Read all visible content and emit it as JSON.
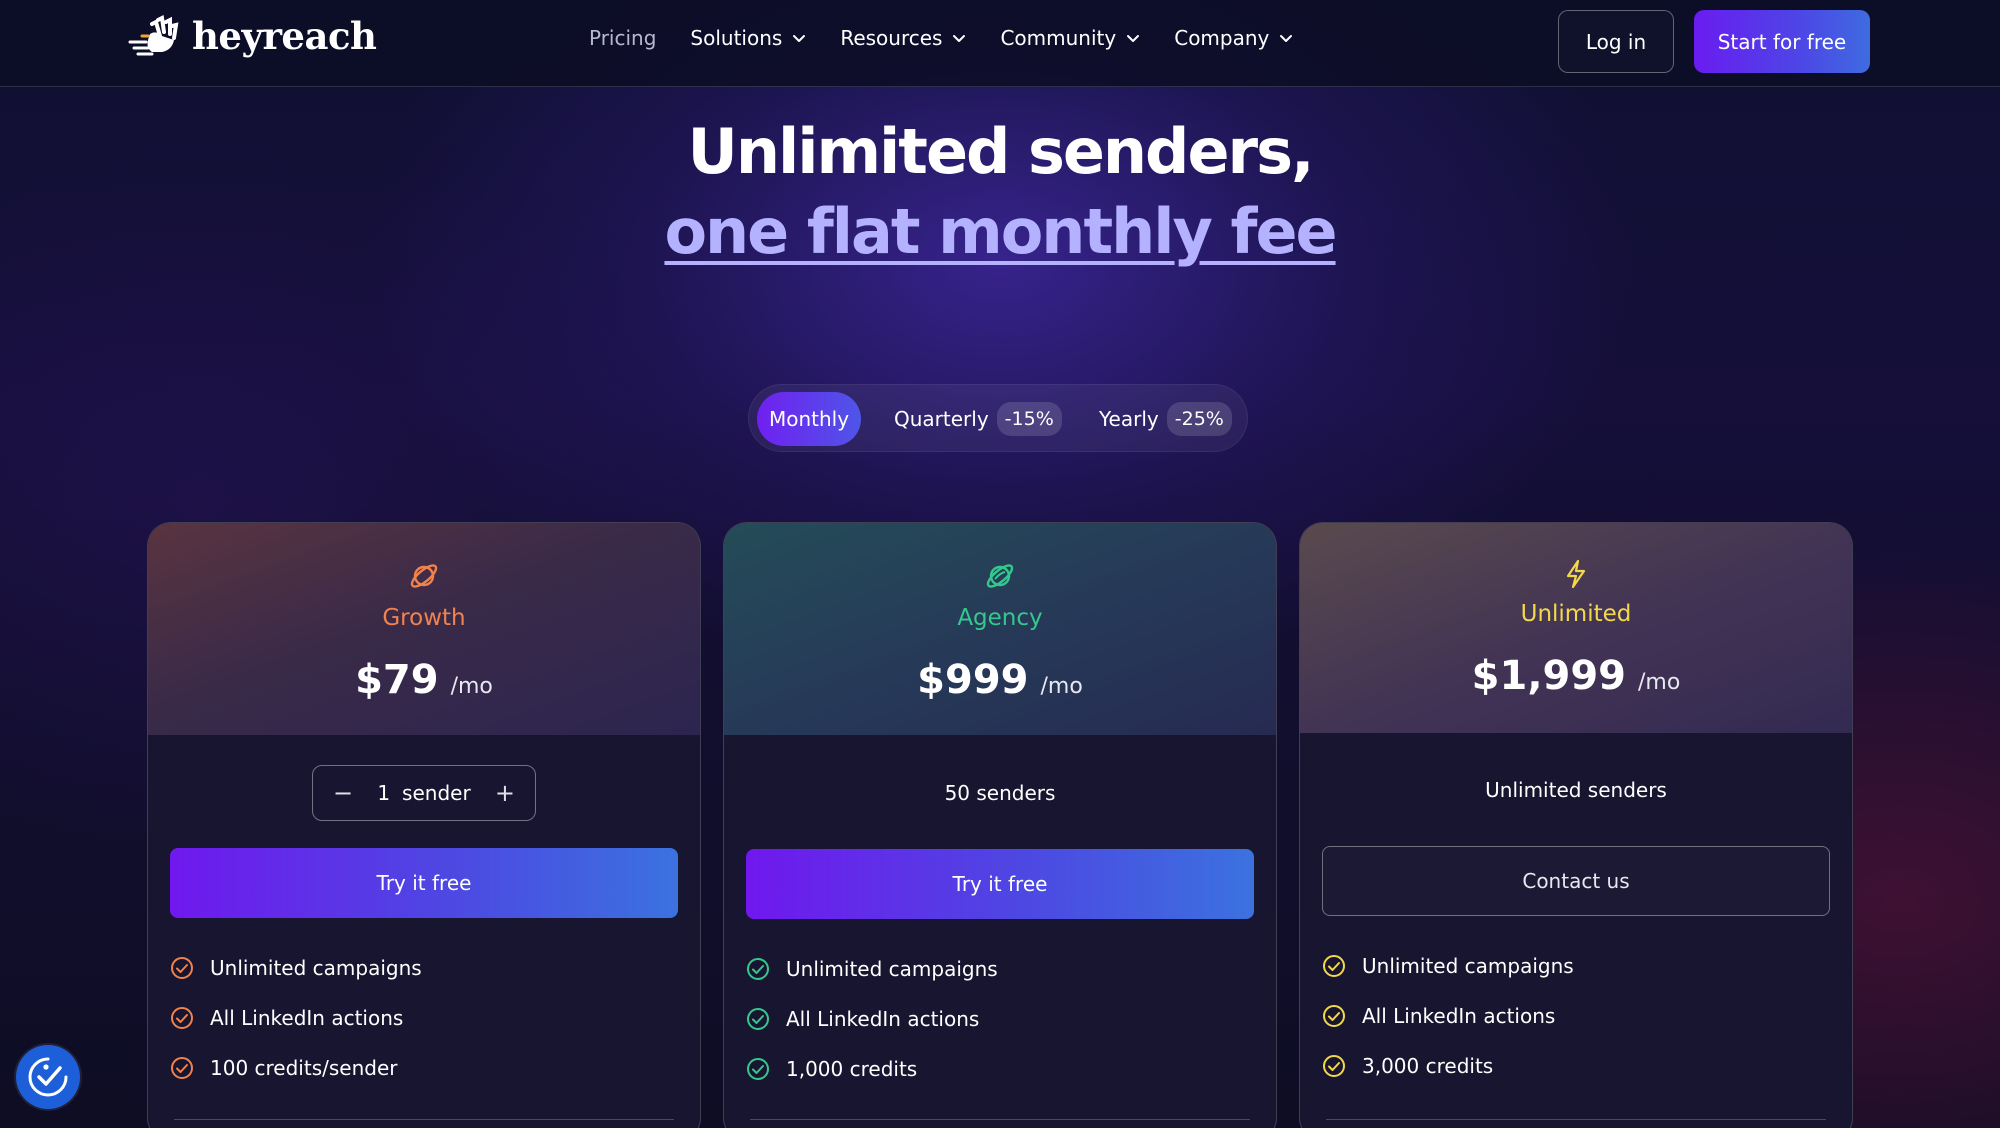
{
  "brand": {
    "name": "heyreach"
  },
  "nav": {
    "links": [
      {
        "label": "Pricing",
        "has_dropdown": false
      },
      {
        "label": "Solutions",
        "has_dropdown": true
      },
      {
        "label": "Resources",
        "has_dropdown": true
      },
      {
        "label": "Community",
        "has_dropdown": true
      },
      {
        "label": "Company",
        "has_dropdown": true
      }
    ],
    "login_label": "Log in",
    "start_label": "Start for free"
  },
  "hero": {
    "line1": "Unlimited senders,",
    "line2": "one flat monthly fee"
  },
  "billing_toggle": {
    "selected": "Monthly",
    "options": [
      {
        "label": "Monthly",
        "discount": ""
      },
      {
        "label": "Quarterly",
        "discount": "-15%"
      },
      {
        "label": "Yearly",
        "discount": "-25%"
      }
    ]
  },
  "plans": [
    {
      "name": "Growth",
      "icon": "planet-icon",
      "accent": "#f0824e",
      "price": "$79",
      "period": "/mo",
      "stepper": {
        "value": "1",
        "unit": "sender",
        "minus": "−",
        "plus": "+"
      },
      "cta": "Try it free",
      "features": [
        "Unlimited campaigns",
        "All LinkedIn actions",
        "100 credits/sender"
      ]
    },
    {
      "name": "Agency",
      "icon": "planet-icon",
      "accent": "#35c88e",
      "price": "$999",
      "period": "/mo",
      "senders": "50 senders",
      "cta": "Try it free",
      "features": [
        "Unlimited campaigns",
        "All LinkedIn actions",
        "1,000 credits"
      ]
    },
    {
      "name": "Unlimited",
      "icon": "lightning-icon",
      "accent": "#f2d94a",
      "price": "$1,999",
      "period": "/mo",
      "senders": "Unlimited senders",
      "cta": "Contact us",
      "features": [
        "Unlimited campaigns",
        "All LinkedIn actions",
        "3,000 credits"
      ]
    }
  ],
  "colors": {
    "primary_gradient_start": "#6a1cf0",
    "primary_gradient_end": "#3f6be0",
    "background": "#0c0d24"
  },
  "accessibility_widget": {
    "icon": "accessibility-check-icon"
  }
}
